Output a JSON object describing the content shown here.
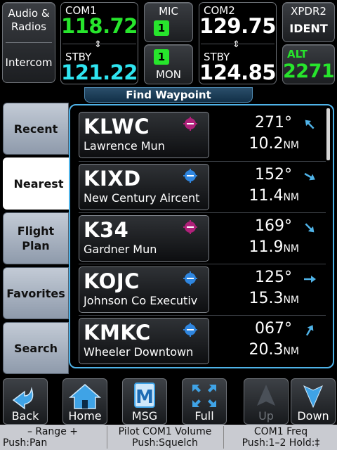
{
  "radio": {
    "audio_label1": "Audio &",
    "audio_label2": "Radios",
    "intercom_label": "Intercom",
    "com1": {
      "label": "COM1",
      "active": "118.72",
      "stby_label": "STBY",
      "standby": "121.22"
    },
    "mic_label": "MIC",
    "mic_badge": "1",
    "mon_label": "MON",
    "mon_badge": "1",
    "com2": {
      "label": "COM2",
      "active": "129.75",
      "stby_label": "STBY",
      "standby": "124.85"
    },
    "xpdr_label": "XPDR2",
    "ident_label": "IDENT",
    "alt_label": "ALT",
    "squawk": "2271"
  },
  "title": "Find Waypoint",
  "tabs": [
    {
      "label1": "Recent",
      "label2": ""
    },
    {
      "label1": "Nearest",
      "label2": ""
    },
    {
      "label1": "Flight",
      "label2": "Plan"
    },
    {
      "label1": "Favorites",
      "label2": ""
    },
    {
      "label1": "Search",
      "label2": ""
    }
  ],
  "waypoints": [
    {
      "ident": "KLWC",
      "name": "Lawrence Mun",
      "bearing": "271°",
      "distance": "10.2",
      "unit": "NM",
      "icon": "airport-magenta-icon",
      "arrow_deg": 225
    },
    {
      "ident": "KIXD",
      "name": "New Century Aircent",
      "bearing": "152°",
      "distance": "11.4",
      "unit": "NM",
      "icon": "airport-blue-icon",
      "arrow_deg": 30
    },
    {
      "ident": "K34",
      "name": "Gardner Mun",
      "bearing": "169°",
      "distance": "11.9",
      "unit": "NM",
      "icon": "airport-magenta-icon",
      "arrow_deg": 45
    },
    {
      "ident": "KOJC",
      "name": "Johnson Co Executiv",
      "bearing": "125°",
      "distance": "15.3",
      "unit": "NM",
      "icon": "airport-blue-icon",
      "arrow_deg": 0
    },
    {
      "ident": "KMKC",
      "name": "Wheeler Downtown",
      "bearing": "067°",
      "distance": "20.3",
      "unit": "NM",
      "icon": "airport-blue-icon",
      "arrow_deg": -60
    }
  ],
  "colors": {
    "active": "#27e52c",
    "standby": "#2fe4f0",
    "accent": "#4fb3e8",
    "magenta": "#b0207a",
    "blue": "#2f86e0"
  },
  "buttons": {
    "back": "Back",
    "home": "Home",
    "msg": "MSG",
    "msg_icon_letter": "M",
    "full": "Full",
    "up": "Up",
    "down": "Down"
  },
  "knobs": {
    "left1": "– Range +",
    "left2": "Push:Pan",
    "mid1": "Pilot COM1 Volume",
    "mid2": "Push:Squelch",
    "right1": "COM1 Freq",
    "right2": "Push:1–2 Hold:‡"
  }
}
